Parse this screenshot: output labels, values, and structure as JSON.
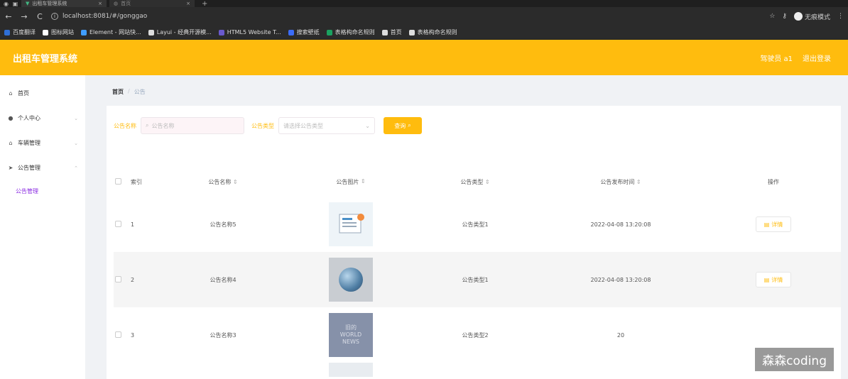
{
  "browser": {
    "tabs": [
      {
        "title": "出租车管理系统",
        "active": true
      },
      {
        "title": "首页",
        "active": false
      }
    ],
    "url": "localhost:8081/#/gonggao",
    "profile_label": "无痕模式",
    "bookmarks": [
      {
        "label": "百度翻译",
        "color": "#2f6fd6"
      },
      {
        "label": "图标网站",
        "color": "#ffffff"
      },
      {
        "label": "Element - 网站快...",
        "color": "#409eff"
      },
      {
        "label": "Layui - 经典开源模...",
        "color": "#dddddd"
      },
      {
        "label": "HTML5 Website T...",
        "color": "#6a5acd"
      },
      {
        "label": "搜索壁纸",
        "color": "#3b6cf6"
      },
      {
        "label": "表格构命名规则",
        "color": "#1aa260"
      },
      {
        "label": "首页",
        "color": "#dddddd"
      },
      {
        "label": "表格构命名规则",
        "color": "#dddddd"
      }
    ]
  },
  "app": {
    "title": "出租车管理系统",
    "user_label": "驾驶员 a1",
    "logout_label": "退出登录",
    "accent": "#ffbc0e"
  },
  "sidebar": {
    "items": [
      {
        "label": "首页",
        "icon": "home-icon"
      },
      {
        "label": "个人中心",
        "icon": "user-icon"
      },
      {
        "label": "车辆管理",
        "icon": "bank-icon"
      },
      {
        "label": "公告管理",
        "icon": "send-icon"
      }
    ],
    "submenu": {
      "label": "公告管理"
    }
  },
  "breadcrumb": {
    "home": "首页",
    "separator": "/",
    "current": "公告"
  },
  "search": {
    "name_label": "公告名称",
    "name_placeholder": "公告名称",
    "type_label": "公告类型",
    "type_placeholder": "请选择公告类型",
    "query_button": "查询"
  },
  "table": {
    "headers": {
      "index": "索引",
      "name": "公告名称",
      "image": "公告图片",
      "type": "公告类型",
      "time": "公告发布时间",
      "op": "操作"
    },
    "rows": [
      {
        "index": "1",
        "name": "公告名称5",
        "type": "公告类型1",
        "time": "2022-04-08 13:20:08",
        "op": "详情"
      },
      {
        "index": "2",
        "name": "公告名称4",
        "type": "公告类型1",
        "time": "2022-04-08 13:20:08",
        "op": "详情"
      },
      {
        "index": "3",
        "name": "公告名称3",
        "type": "公告类型2",
        "time": "20",
        "op": ""
      }
    ],
    "thumb3_text": [
      "旧的",
      "WORLD",
      "NEWS"
    ]
  },
  "watermark": "森森coding"
}
